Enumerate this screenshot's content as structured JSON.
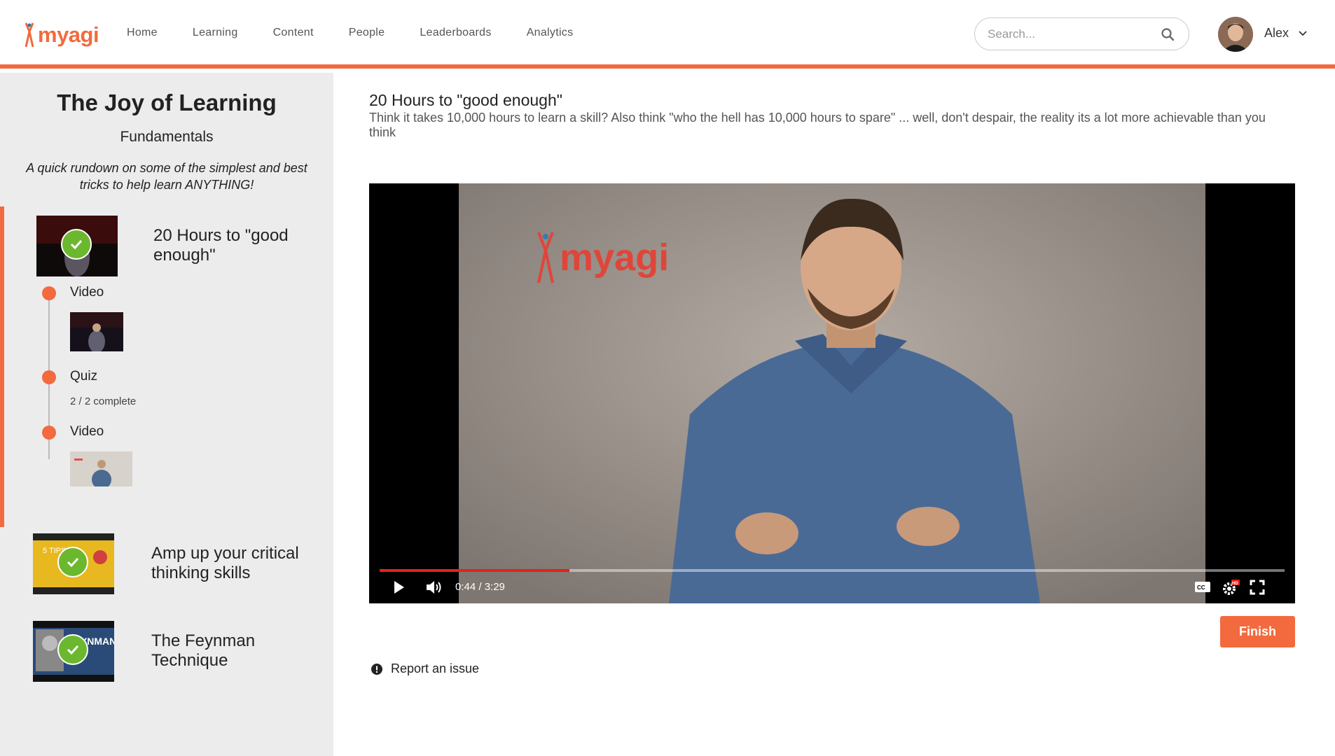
{
  "header": {
    "logo_text": "myagi",
    "nav": [
      "Home",
      "Learning",
      "Content",
      "People",
      "Leaderboards",
      "Analytics"
    ],
    "search_placeholder": "Search...",
    "user_name": "Alex"
  },
  "sidebar": {
    "course_title": "The Joy of Learning",
    "course_subtitle": "Fundamentals",
    "course_description": "A quick rundown on some of the simplest and best tricks to help learn ANYTHING!",
    "lessons": [
      {
        "title": "20 Hours to \"good enough\"",
        "completed": true,
        "steps": [
          {
            "label": "Video"
          },
          {
            "label": "Quiz",
            "meta": "2 / 2 complete"
          },
          {
            "label": "Video"
          }
        ]
      },
      {
        "title": "Amp up your critical thinking skills",
        "completed": true
      },
      {
        "title": "The Feynman Technique",
        "completed": true
      }
    ]
  },
  "main": {
    "title": "20 Hours to \"good enough\"",
    "description": "Think it takes 10,000 hours to learn a skill? Also think \"who the hell has 10,000 hours to spare\" ... well, don't despair, the reality its a lot more achievable than you think",
    "video": {
      "watermark": "myagi",
      "current_time": "0:44",
      "duration": "3:29",
      "time_display": "0:44 / 3:29",
      "progress_fraction": 0.21
    },
    "finish_label": "Finish",
    "report_label": "Report an issue"
  },
  "colors": {
    "accent": "#f26a3d",
    "check": "#6bb82e",
    "video_progress": "#e62117"
  }
}
